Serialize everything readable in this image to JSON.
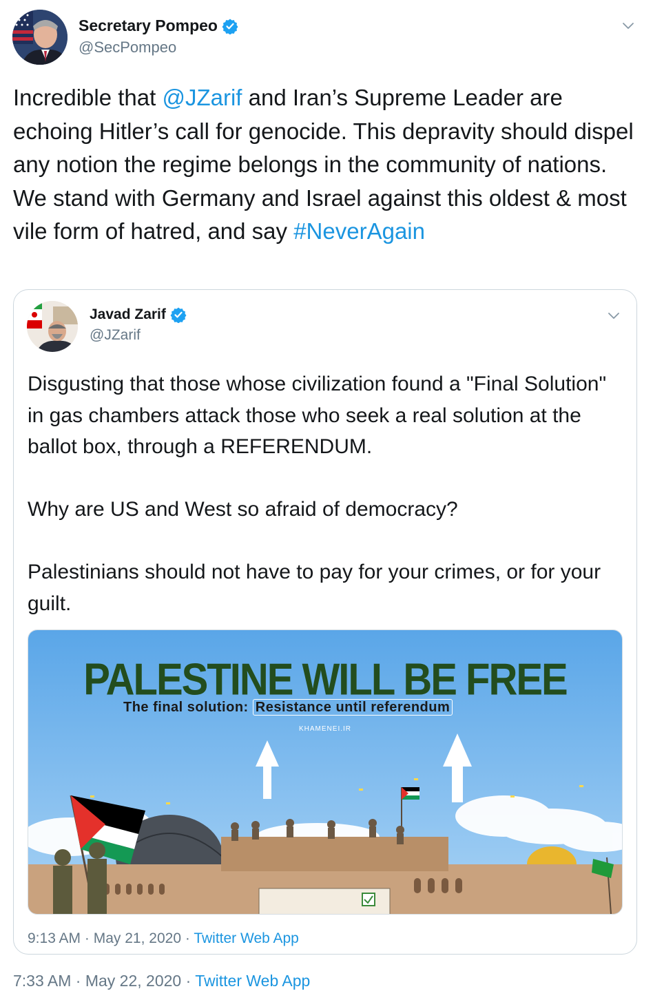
{
  "tweet": {
    "author_name": "Secretary Pompeo",
    "author_handle": "@SecPompeo",
    "text_segments": [
      {
        "text": "Incredible that ",
        "link": false
      },
      {
        "text": "@JZarif",
        "link": true
      },
      {
        "text": " and Iran’s Supreme Leader are echoing Hitler’s call for genocide. This depravity should dispel any notion the regime belongs in the community of nations. We stand with Germany and Israel against this oldest & most vile form of hatred, and say ",
        "link": false
      },
      {
        "text": "#NeverAgain",
        "link": true
      }
    ],
    "time": "7:33 AM",
    "date": "May 22, 2020",
    "separator": "·",
    "source": "Twitter Web App"
  },
  "quoted": {
    "author_name": "Javad Zarif",
    "author_handle": "@JZarif",
    "text": "Disgusting that those whose civilization found a \"Final Solution\" in gas chambers attack those who seek a real solution at the ballot box, through a REFERENDUM.\n\nWhy are US and West so afraid of democracy?\n\nPalestinians should not have to pay for your crimes, or for your guilt.",
    "image": {
      "headline": "PALESTINE WILL BE FREE",
      "subline_lead": "The final solution:",
      "subline_boxed": "Resistance until referendum",
      "brand": "KHAMENEI.IR"
    },
    "time": "9:13 AM",
    "date": "May 21, 2020",
    "separator": "·",
    "source": "Twitter Web App"
  },
  "colors": {
    "link": "#1b95e0",
    "verified": "#1da1f2",
    "muted": "#657786",
    "text": "#14171a",
    "sky": "#6fb2ea",
    "headline_green": "#234d1e"
  },
  "icons": [
    "verified-badge-icon",
    "chevron-down-icon"
  ]
}
